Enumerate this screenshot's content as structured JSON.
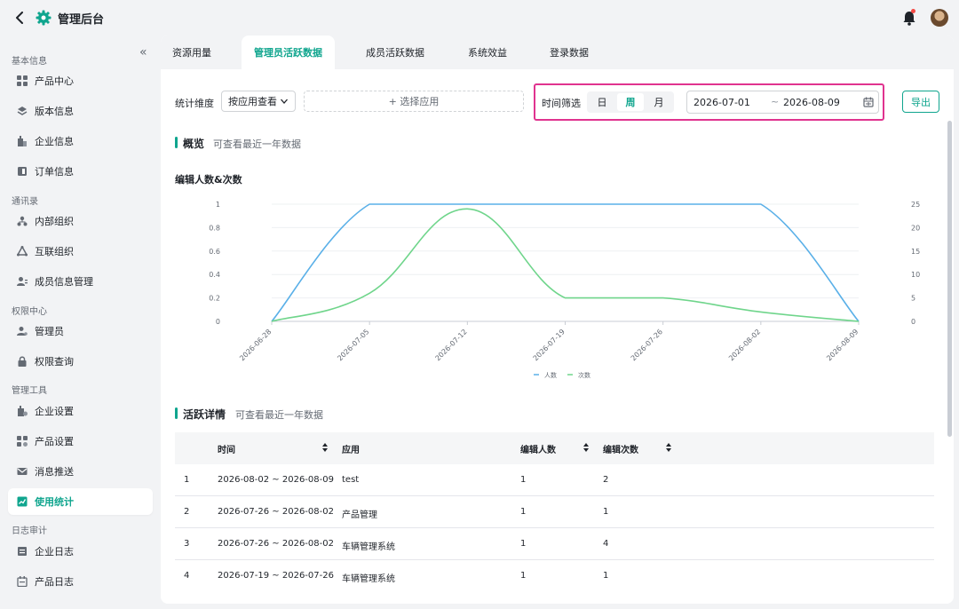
{
  "header": {
    "title": "管理后台"
  },
  "sidebar": {
    "groups": [
      {
        "label": "基本信息"
      },
      {
        "label": "通讯录"
      },
      {
        "label": "权限中心"
      },
      {
        "label": "管理工具"
      },
      {
        "label": "日志审计"
      }
    ],
    "items": [
      {
        "label": "产品中心",
        "icon": "grid-icon"
      },
      {
        "label": "版本信息",
        "icon": "layers-icon"
      },
      {
        "label": "企业信息",
        "icon": "building-icon"
      },
      {
        "label": "订单信息",
        "icon": "order-icon"
      },
      {
        "label": "内部组织",
        "icon": "org-icon"
      },
      {
        "label": "互联组织",
        "icon": "network-icon"
      },
      {
        "label": "成员信息管理",
        "icon": "member-icon"
      },
      {
        "label": "管理员",
        "icon": "admin-icon"
      },
      {
        "label": "权限查询",
        "icon": "lock-icon"
      },
      {
        "label": "企业设置",
        "icon": "building-settings-icon"
      },
      {
        "label": "产品设置",
        "icon": "product-settings-icon"
      },
      {
        "label": "消息推送",
        "icon": "mail-icon"
      },
      {
        "label": "使用统计",
        "icon": "chart-icon",
        "active": true
      },
      {
        "label": "企业日志",
        "icon": "log-icon"
      },
      {
        "label": "产品日志",
        "icon": "calendar-log-icon"
      }
    ]
  },
  "tabs": [
    {
      "label": "资源用量"
    },
    {
      "label": "管理员活跃数据",
      "active": true
    },
    {
      "label": "成员活跃数据"
    },
    {
      "label": "系统效益"
    },
    {
      "label": "登录数据"
    }
  ],
  "filters": {
    "dimension_label": "统计维度",
    "dimension_value": "按应用查看",
    "choose_app": "+ 选择应用",
    "time_label": "时间筛选",
    "granularity": [
      "日",
      "周",
      "月"
    ],
    "granularity_selected": "周",
    "date_start": "2026-07-01",
    "date_sep": "~",
    "date_end": "2026-08-09",
    "export": "导出"
  },
  "overview": {
    "title": "概览",
    "subtitle": "可查看最近一年数据"
  },
  "chart_data": {
    "type": "line",
    "title": "编辑人数&次数",
    "categories": [
      "2026-06-28",
      "2026-07-05",
      "2026-07-12",
      "2026-07-19",
      "2026-07-26",
      "2026-08-02",
      "2026-08-09"
    ],
    "series": [
      {
        "name": "人数",
        "axis": "left",
        "color": "#5ab0e8",
        "values": [
          0,
          1,
          1,
          1,
          1,
          1,
          0
        ]
      },
      {
        "name": "次数",
        "axis": "right",
        "color": "#6fd58b",
        "values": [
          0,
          6,
          24,
          5,
          5,
          2,
          0
        ]
      }
    ],
    "ylim_left": [
      0,
      1
    ],
    "yticks_left": [
      "0",
      "0.2",
      "0.4",
      "0.6",
      "0.8",
      "1"
    ],
    "ylim_right": [
      0,
      25
    ],
    "yticks_right": [
      "0",
      "5",
      "10",
      "15",
      "20",
      "25"
    ],
    "legend_position": "bottom-center"
  },
  "detail": {
    "title": "活跃详情",
    "subtitle": "可查看最近一年数据",
    "columns": [
      "时间",
      "应用",
      "编辑人数",
      "编辑次数"
    ],
    "rows": [
      {
        "idx": "1",
        "time": "2026-08-02 ~ 2026-08-09",
        "app": "test",
        "editors": "1",
        "edits": "2"
      },
      {
        "idx": "2",
        "time": "2026-07-26 ~ 2026-08-02",
        "app": "产品管理",
        "editors": "1",
        "edits": "1"
      },
      {
        "idx": "3",
        "time": "2026-07-26 ~ 2026-08-02",
        "app": "车辆管理系统",
        "editors": "1",
        "edits": "4"
      },
      {
        "idx": "4",
        "time": "2026-07-19 ~ 2026-07-26",
        "app": "车辆管理系统",
        "editors": "1",
        "edits": "1"
      }
    ]
  }
}
